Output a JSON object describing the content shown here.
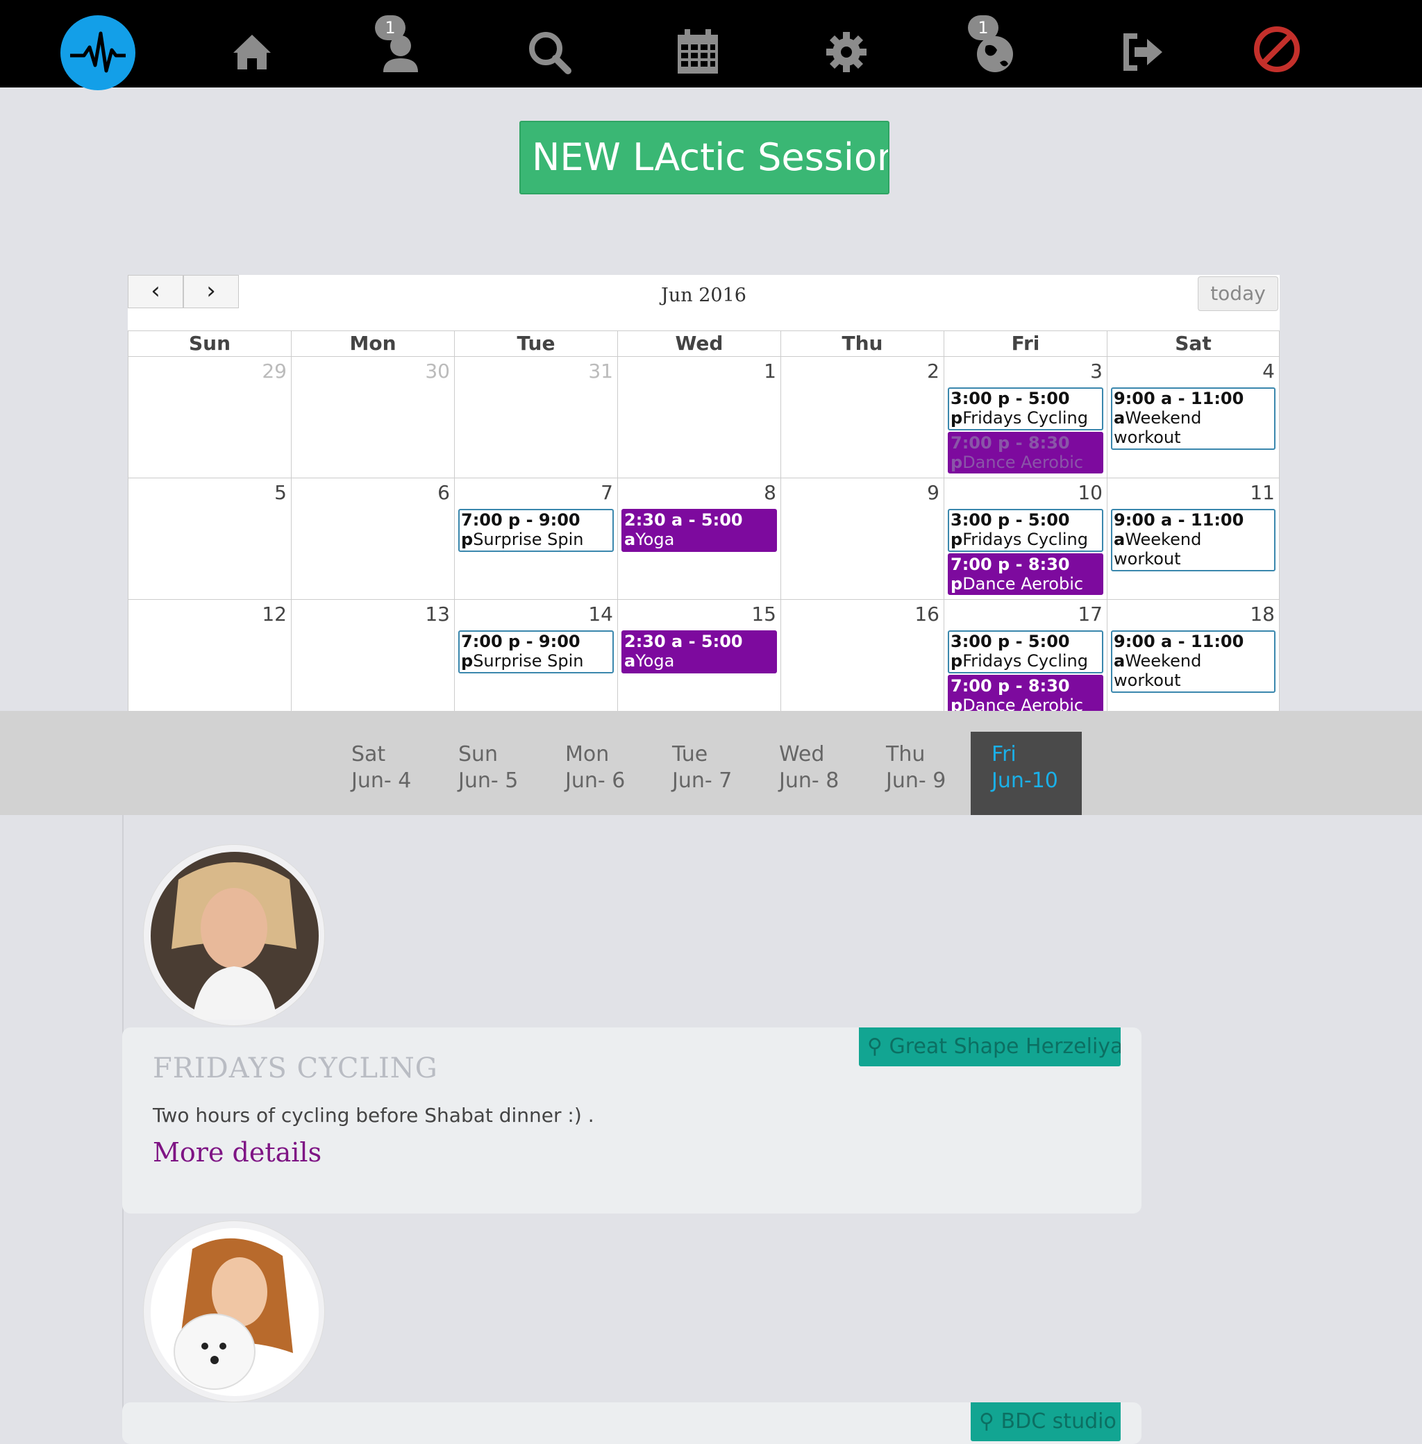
{
  "nav": {
    "badges": {
      "profile": "1",
      "world": "1"
    },
    "icons": [
      "pulse-logo",
      "home-icon",
      "profile-icon",
      "search-icon",
      "calendar-icon",
      "gear-icon",
      "globe-icon",
      "logout-icon",
      "no-entry-icon"
    ]
  },
  "new_session_label": "NEW LActic Session",
  "calendar": {
    "title": "Jun 2016",
    "today_label": "today",
    "prev_label": "‹",
    "next_label": "›",
    "weekdays": [
      "Sun",
      "Mon",
      "Tue",
      "Wed",
      "Thu",
      "Fri",
      "Sat"
    ],
    "weeks": [
      {
        "days": [
          "29",
          "30",
          "31",
          "1",
          "2",
          "3",
          "4"
        ],
        "other_month": [
          true,
          true,
          true,
          false,
          false,
          false,
          false
        ]
      },
      {
        "days": [
          "5",
          "6",
          "7",
          "8",
          "9",
          "10",
          "11"
        ],
        "other_month": [
          false,
          false,
          false,
          false,
          false,
          false,
          false
        ]
      },
      {
        "days": [
          "12",
          "13",
          "14",
          "15",
          "16",
          "17",
          "18"
        ],
        "other_month": [
          false,
          false,
          false,
          false,
          false,
          false,
          false
        ]
      }
    ],
    "events": {
      "fri_cycling": {
        "time": "3:00 p - 5:00",
        "suffix": "p",
        "title": "Fridays Cycling"
      },
      "fri_dance": {
        "time": "7:00 p - 8:30",
        "suffix": "p",
        "title": "Dance Aerobic"
      },
      "sat_workout": {
        "time": "9:00 a - 11:00",
        "suffix": "a",
        "title": "Weekend workout"
      },
      "tue_spin": {
        "time": "7:00 p - 9:00",
        "suffix": "p",
        "title": "Surprise Spin"
      },
      "wed_yoga": {
        "time": "2:30 a - 5:00",
        "suffix": "a",
        "title": "Yoga"
      }
    }
  },
  "day_tabs": [
    {
      "dow": "Sat",
      "date": "Jun- 4"
    },
    {
      "dow": "Sun",
      "date": "Jun- 5"
    },
    {
      "dow": "Mon",
      "date": "Jun- 6"
    },
    {
      "dow": "Tue",
      "date": "Jun- 7"
    },
    {
      "dow": "Wed",
      "date": "Jun- 8"
    },
    {
      "dow": "Thu",
      "date": "Jun- 9"
    },
    {
      "dow": "Fri",
      "date": "Jun-10"
    }
  ],
  "sessions": [
    {
      "location": "Great Shape Herzeliya.",
      "title": "FRIDAYS CYCLING",
      "description": "Two hours of cycling before Shabat dinner :) .",
      "more": "More details"
    },
    {
      "location": "BDC studio"
    }
  ],
  "colors": {
    "accent": "#139fe8",
    "new_button": "#3ab774",
    "event_purple": "#7d0a9e",
    "location_tag": "#12a592",
    "active_tab": "#1ab0e8"
  }
}
